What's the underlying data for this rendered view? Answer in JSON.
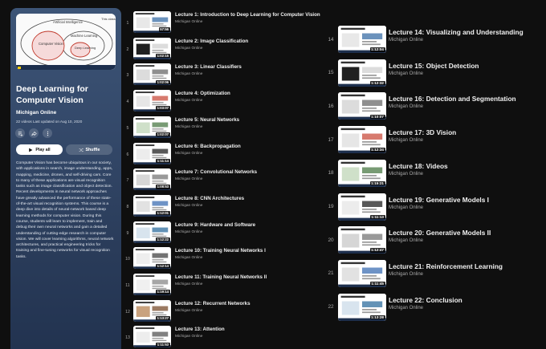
{
  "playlist": {
    "title": "Deep Learning for Computer Vision",
    "channel": "Michigan Online",
    "meta": "22 videos  Last updated on Aug 10, 2020",
    "play_all": "Play all",
    "shuffle": "Shuffle",
    "description": "Computer Vision has become ubiquitous in our society, with applications in search, image understanding, apps, mapping, medicine, drones, and self-driving cars. Core to many of these applications are visual recognition tasks such as image classification and object detection. Recent developments in neural network approaches have greatly advanced the performance of these state-of-the-art visual recognition systems. This course is a deep dive into details of neural-network based deep learning methods for computer vision. During this course, students will learn to implement, train and debug their own neural networks and gain a detailed understanding of cutting-edge research in computer vision. We will cover learning algorithms, neural network architectures, and practical engineering tricks for training and fine-tuning networks for visual recognition tasks.",
    "hero": {
      "label_top": "This class",
      "label_ai": "Artificial Intelligence",
      "label_ml": "Machine Learning",
      "label_cv": "Computer Vision",
      "label_dl": "Deep Learning"
    },
    "accent_color": "#3d5577"
  },
  "videos": [
    {
      "index": "1",
      "title": "Lecture 1: Introduction to Deep Learning for Computer Vision",
      "channel": "Michigan Online",
      "duration": "57:56"
    },
    {
      "index": "2",
      "title": "Lecture 2: Image Classification",
      "channel": "Michigan Online",
      "duration": "1:02:15"
    },
    {
      "index": "3",
      "title": "Lecture 3: Linear Classifiers",
      "channel": "Michigan Online",
      "duration": "1:02:06"
    },
    {
      "index": "4",
      "title": "Lecture 4: Optimization",
      "channel": "Michigan Online",
      "duration": "1:03:07"
    },
    {
      "index": "5",
      "title": "Lecture 5: Neural Networks",
      "channel": "Michigan Online",
      "duration": "1:02:07"
    },
    {
      "index": "6",
      "title": "Lecture 6: Backpropagation",
      "channel": "Michigan Online",
      "duration": "1:11:14"
    },
    {
      "index": "7",
      "title": "Lecture 7: Convolutional Networks",
      "channel": "Michigan Online",
      "duration": "1:08:53"
    },
    {
      "index": "8",
      "title": "Lecture 8: CNN Architectures",
      "channel": "Michigan Online",
      "duration": "1:12:01"
    },
    {
      "index": "9",
      "title": "Lecture 9: Hardware and Software",
      "channel": "Michigan Online",
      "duration": "1:12:22"
    },
    {
      "index": "10",
      "title": "Lecture 10: Training Neural Networks I",
      "channel": "Michigan Online",
      "duration": "1:12:14"
    },
    {
      "index": "11",
      "title": "Lecture 11: Training Neural Networks II",
      "channel": "Michigan Online",
      "duration": "1:19:14"
    },
    {
      "index": "12",
      "title": "Lecture 12: Recurrent Networks",
      "channel": "Michigan Online",
      "duration": "1:13:27"
    },
    {
      "index": "13",
      "title": "Lecture 13: Attention",
      "channel": "Michigan Online",
      "duration": "1:11:53"
    },
    {
      "index": "14",
      "title": "Lecture 14: Visualizing and Understanding",
      "channel": "Michigan Online",
      "duration": "1:12:04"
    },
    {
      "index": "15",
      "title": "Lecture 15: Object Detection",
      "channel": "Michigan Online",
      "duration": "1:12:32"
    },
    {
      "index": "16",
      "title": "Lecture 16: Detection and Segmentation",
      "channel": "Michigan Online",
      "duration": "1:10:07"
    },
    {
      "index": "17",
      "title": "Lecture 17: 3D Vision",
      "channel": "Michigan Online",
      "duration": "1:12:34"
    },
    {
      "index": "18",
      "title": "Lecture 18: Videos",
      "channel": "Michigan Online",
      "duration": "1:15:21"
    },
    {
      "index": "19",
      "title": "Lecture 19: Generative Models I",
      "channel": "Michigan Online",
      "duration": "1:11:13"
    },
    {
      "index": "20",
      "title": "Lecture 20: Generative Models II",
      "channel": "Michigan Online",
      "duration": "1:12:47"
    },
    {
      "index": "21",
      "title": "Lecture 21: Reinforcement Learning",
      "channel": "Michigan Online",
      "duration": "1:11:45"
    },
    {
      "index": "22",
      "title": "Lecture 22: Conclusion",
      "channel": "Michigan Online",
      "duration": "1:13:28"
    }
  ],
  "icons": {
    "save": "playlist-add-icon",
    "share": "share-icon",
    "more": "more-vert-icon",
    "play": "play-icon",
    "shuffle": "shuffle-icon"
  }
}
